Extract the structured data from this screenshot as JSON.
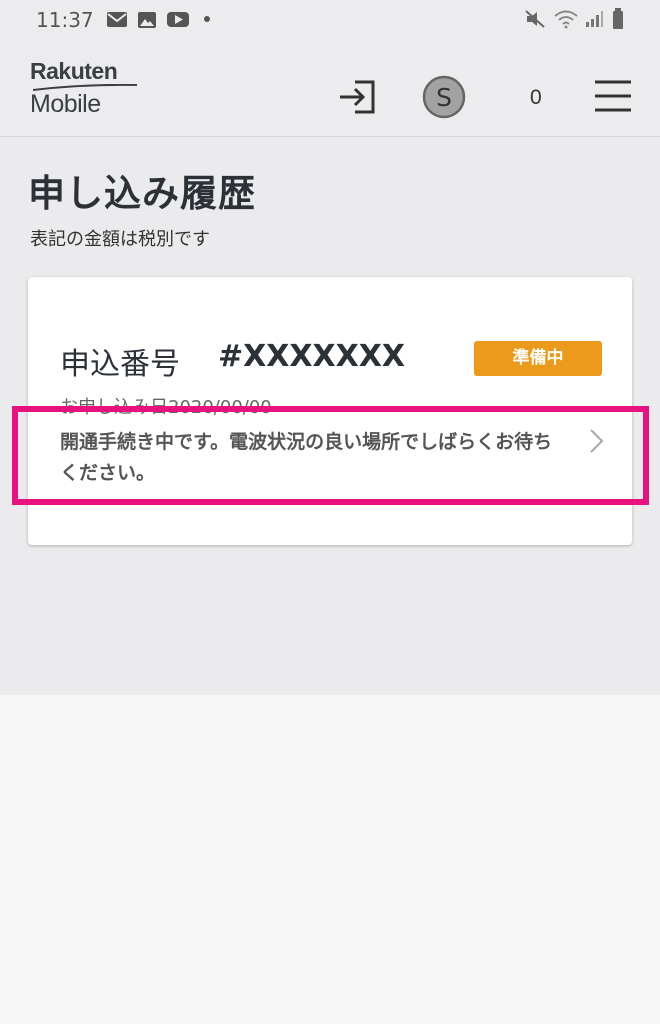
{
  "status_bar": {
    "time": "11:37"
  },
  "header": {
    "logo_top": "Rakuten",
    "logo_bottom": "Mobile",
    "cart_count": "0"
  },
  "page": {
    "title": "申し込み履歴",
    "note": "表記の金額は税別です"
  },
  "order": {
    "label": "申込番号",
    "number": "#XXXXXXX",
    "status": "準備中",
    "date": "お申し込み日2020/00/00",
    "message": "開通手続き中です。電波状況の良い場所でしばらくお待ちください。"
  },
  "colors": {
    "badge": "#ec9a1c",
    "highlight": "#e8127f"
  }
}
